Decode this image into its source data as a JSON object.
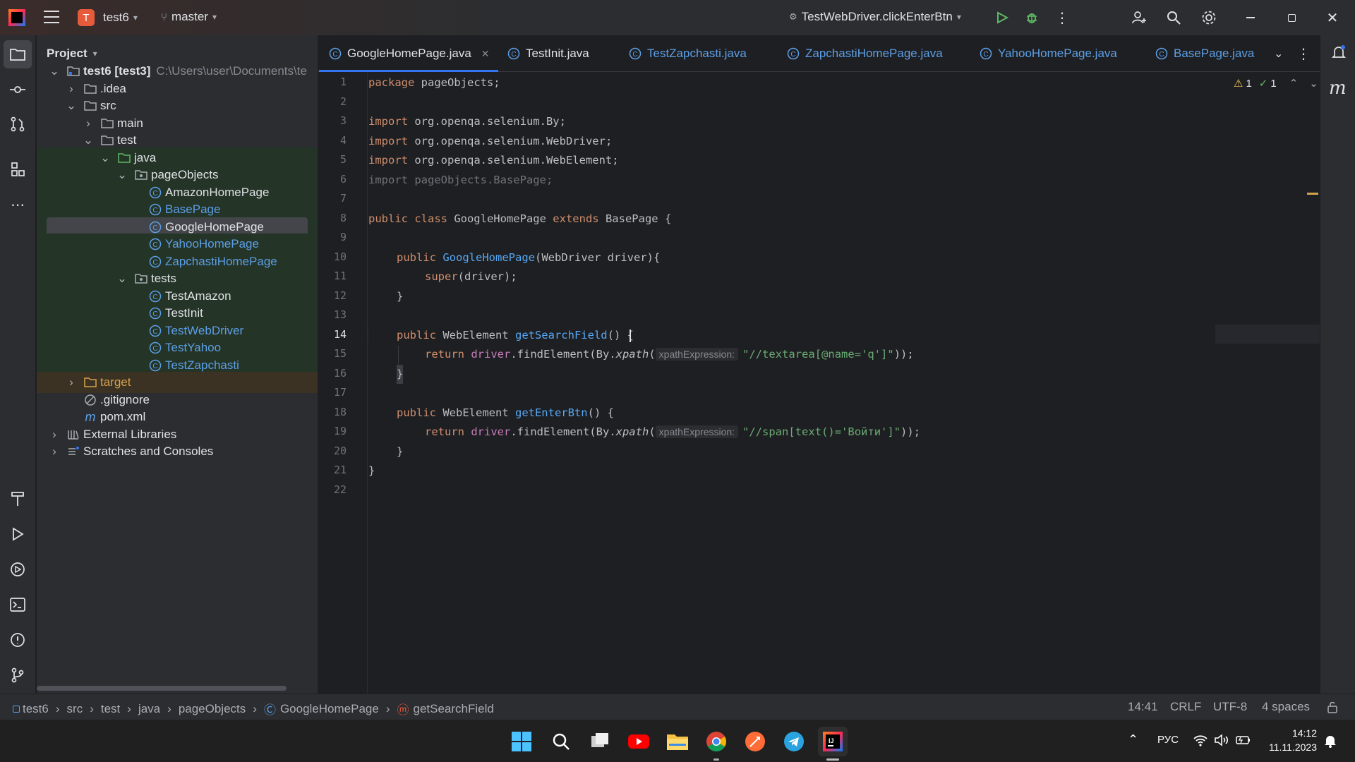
{
  "titlebar": {
    "project_badge": "T",
    "project_name": "test6",
    "branch": "master",
    "run_config": "TestWebDriver.clickEnterBtn"
  },
  "project_panel": {
    "title": "Project",
    "tree": [
      {
        "label": "test6 [test3]",
        "extra": "C:\\Users\\user\\Documents\\te",
        "type": "module"
      },
      {
        "label": ".idea",
        "type": "folder"
      },
      {
        "label": "src",
        "type": "folder"
      },
      {
        "label": "main",
        "type": "folder"
      },
      {
        "label": "test",
        "type": "folder"
      },
      {
        "label": "java",
        "type": "folder"
      },
      {
        "label": "pageObjects",
        "type": "package"
      },
      {
        "label": "AmazonHomePage",
        "type": "class"
      },
      {
        "label": "BasePage",
        "type": "class"
      },
      {
        "label": "GoogleHomePage",
        "type": "class"
      },
      {
        "label": "YahooHomePage",
        "type": "class"
      },
      {
        "label": "ZapchastiHomePage",
        "type": "class"
      },
      {
        "label": "tests",
        "type": "package"
      },
      {
        "label": "TestAmazon",
        "type": "class"
      },
      {
        "label": "TestInit",
        "type": "class"
      },
      {
        "label": "TestWebDriver",
        "type": "class"
      },
      {
        "label": "TestYahoo",
        "type": "class"
      },
      {
        "label": "TestZapchasti",
        "type": "class"
      },
      {
        "label": "target",
        "type": "folder"
      },
      {
        "label": ".gitignore",
        "type": "file"
      },
      {
        "label": "pom.xml",
        "type": "file"
      },
      {
        "label": "External Libraries",
        "type": "lib"
      },
      {
        "label": "Scratches and Consoles",
        "type": "scratch"
      }
    ]
  },
  "tabs": [
    {
      "label": "GoogleHomePage.java",
      "active": true
    },
    {
      "label": "TestInit.java"
    },
    {
      "label": "TestZapchasti.java"
    },
    {
      "label": "ZapchastiHomePage.java"
    },
    {
      "label": "YahooHomePage.java"
    },
    {
      "label": "BasePage.java"
    }
  ],
  "editor": {
    "line_numbers": [
      "1",
      "2",
      "3",
      "4",
      "5",
      "6",
      "7",
      "8",
      "9",
      "10",
      "11",
      "12",
      "13",
      "14",
      "15",
      "16",
      "17",
      "18",
      "19",
      "20",
      "21",
      "22"
    ],
    "inspections": {
      "warnings": "1",
      "ok": "1"
    },
    "lines": {
      "l1_kw": "package",
      "l1_rest": " pageObjects;",
      "l3_kw": "import",
      "l3_rest": " org.openqa.selenium.By;",
      "l4_kw": "import",
      "l4_rest": " org.openqa.selenium.WebDriver;",
      "l5_kw": "import",
      "l5_rest": " org.openqa.selenium.WebElement;",
      "l6": "import pageObjects.BasePage;",
      "l8_a": "public class",
      "l8_b": " GoogleHomePage ",
      "l8_c": "extends",
      "l8_d": " BasePage {",
      "l10_kw": "public",
      "l10_fn": "GoogleHomePage",
      "l10_rest": "(WebDriver driver){",
      "l11_kw": "super",
      "l11_rest": "(driver);",
      "l12": "}",
      "l14_kw": "public",
      "l14_type": " WebElement ",
      "l14_fn": "getSearchField",
      "l14_rest": "() {",
      "l15_kw": "return",
      "l15_a": " driver",
      "l15_b": ".findElement(By.",
      "l15_c": "xpath",
      "l15_d": "(",
      "l15_hint": "xpathExpression:",
      "l15_str": "\"//textarea[@name='q']\"",
      "l15_end": "));",
      "l16": "}",
      "l18_kw": "public",
      "l18_type": " WebElement ",
      "l18_fn": "getEnterBtn",
      "l18_rest": "() {",
      "l19_kw": "return",
      "l19_a": " driver",
      "l19_b": ".findElement(By.",
      "l19_c": "xpath",
      "l19_d": "(",
      "l19_hint": "xpathExpression:",
      "l19_str": "\"//span[text()='Войти']\"",
      "l19_end": "));",
      "l20": "}",
      "l21": "}"
    }
  },
  "statusbar": {
    "breadcrumb": [
      "test6",
      "src",
      "test",
      "java",
      "pageObjects",
      "GoogleHomePage",
      "getSearchField"
    ],
    "position": "14:41",
    "line_ending": "CRLF",
    "encoding": "UTF-8",
    "indent": "4 spaces"
  },
  "taskbar": {
    "language": "РУС",
    "time": "14:12",
    "date": "11.11.2023"
  }
}
